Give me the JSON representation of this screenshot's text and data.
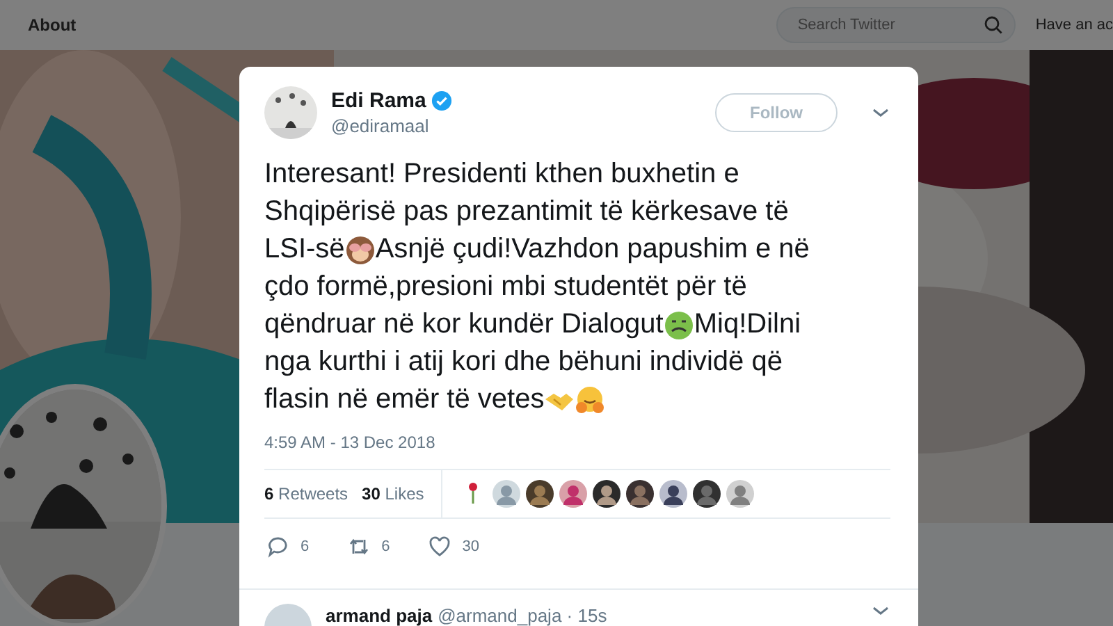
{
  "topbar": {
    "title": "About",
    "search": {
      "placeholder": "Search Twitter"
    },
    "login_text": "Have an ac"
  },
  "tweet": {
    "author": {
      "name": "Edi Rama",
      "handle": "@ediramaal",
      "verified": true
    },
    "follow_button": "Follow",
    "body": [
      [
        {
          "kind": "text",
          "text": "Interesant! Presidenti kthen buxhetin e"
        }
      ],
      [
        {
          "kind": "text",
          "text": "Shqipërisë pas prezantimit të kërkesave të"
        }
      ],
      [
        {
          "kind": "text",
          "text": "LSI-së"
        },
        {
          "kind": "monkey"
        },
        {
          "kind": "text",
          "text": "Asnjë çudi!Vazhdon papushim e në"
        }
      ],
      [
        {
          "kind": "text",
          "text": "çdo formë,presioni mbi studentët për të"
        }
      ],
      [
        {
          "kind": "text",
          "text": "qëndruar në kor kundër Dialogut"
        },
        {
          "kind": "sick"
        },
        {
          "kind": "text",
          "text": "Miq!Dilni"
        }
      ],
      [
        {
          "kind": "text",
          "text": "nga kurthi i atij kori dhe bëhuni individë që"
        }
      ],
      [
        {
          "kind": "text",
          "text": "flasin në emër të vetes"
        },
        {
          "kind": "handshake"
        },
        {
          "kind": "hug"
        }
      ]
    ],
    "timestamp": "4:59 AM - 13 Dec 2018",
    "stats": [
      "**6** Retweets",
      "**30** Likes"
    ],
    "actions": [
      {
        "kind": "reply",
        "count": "6"
      },
      {
        "kind": "retweet",
        "count": "6"
      },
      {
        "kind": "like",
        "count": "30"
      }
    ]
  },
  "reply": {
    "name": "armand paja",
    "meta": "@armand_paja · 15s"
  }
}
